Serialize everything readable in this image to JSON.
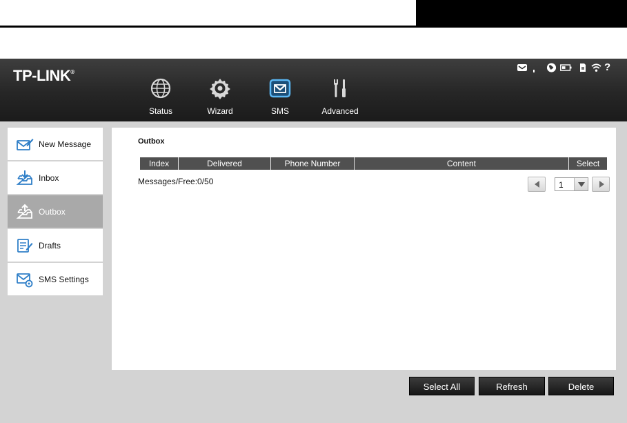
{
  "brand": {
    "logo_text": "TP-LINK",
    "trademark": "®"
  },
  "nav": [
    {
      "id": "status",
      "label": "Status",
      "icon": "globe-icon"
    },
    {
      "id": "wizard",
      "label": "Wizard",
      "icon": "gear-icon"
    },
    {
      "id": "sms",
      "label": "SMS",
      "icon": "envelope-icon",
      "active": true
    },
    {
      "id": "advanced",
      "label": "Advanced",
      "icon": "tools-icon"
    }
  ],
  "status_bar": {
    "icons": [
      "message-icon",
      "signal-icon",
      "internet-globe-icon",
      "battery-icon",
      "sim-card-icon",
      "wifi-icon",
      "help-icon"
    ],
    "help_label": "?"
  },
  "sidebar": {
    "items": [
      {
        "label": "New Message",
        "icon": "compose-icon"
      },
      {
        "label": "Inbox",
        "icon": "inbox-icon"
      },
      {
        "label": "Outbox",
        "icon": "outbox-icon",
        "active": true
      },
      {
        "label": "Drafts",
        "icon": "drafts-icon"
      },
      {
        "label": "SMS Settings",
        "icon": "sms-settings-icon"
      }
    ]
  },
  "outbox": {
    "title": "Outbox",
    "columns": [
      "Index",
      "Delivered",
      "Phone Number",
      "Content",
      "Select"
    ],
    "rows": [],
    "message_count": "Messages/Free:0/50",
    "page": {
      "current": "1"
    }
  },
  "actions": {
    "select_all": "Select All",
    "refresh": "Refresh",
    "delete": "Delete"
  },
  "colors": {
    "header_bg": "#262626",
    "active_icon": "#5bb8f5",
    "sidebar_icon": "#2f7fc8",
    "active_sidebar": "#a9a9a9",
    "table_header": "#505050"
  }
}
